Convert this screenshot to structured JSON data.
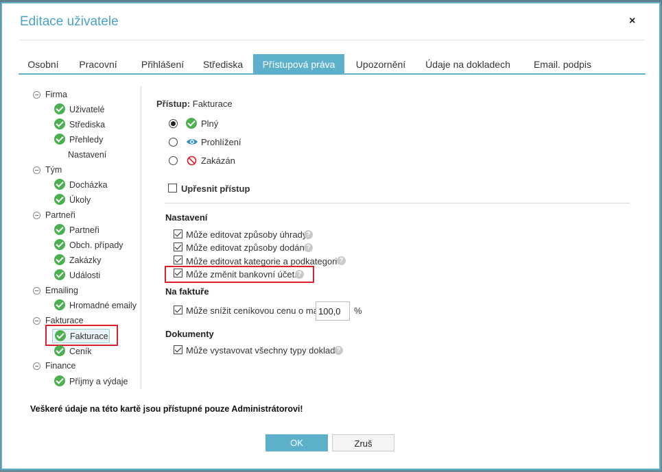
{
  "dialog": {
    "title": "Editace uživatele",
    "close_glyph": "×"
  },
  "tabs": [
    {
      "label": "Osobní"
    },
    {
      "label": "Pracovní"
    },
    {
      "label": "Přihlášení"
    },
    {
      "label": "Střediska"
    },
    {
      "label": "Přístupová práva",
      "active": true
    },
    {
      "label": "Upozornění"
    },
    {
      "label": "Údaje na dokladech"
    },
    {
      "label": "Email. podpis"
    }
  ],
  "tree": {
    "firma": "Firma",
    "uzivatele": "Uživatelé",
    "strediska": "Střediska",
    "prehledy": "Přehledy",
    "nastaveni": "Nastavení",
    "tym": "Tým",
    "dochazka": "Docházka",
    "ukoly": "Úkoly",
    "partneri_group": "Partneři",
    "partneri": "Partneři",
    "obch_pripady": "Obch. případy",
    "zakazky": "Zakázky",
    "udalosti": "Události",
    "emailing": "Emailing",
    "hromadne_emaily": "Hromadné emaily",
    "fakturace_group": "Fakturace",
    "fakturace": "Fakturace",
    "cenik": "Ceník",
    "finance": "Finance",
    "prijmy_vydaje": "Příjmy a výdaje"
  },
  "access": {
    "label": "Přístup:",
    "module": "Fakturace",
    "options": {
      "full": "Plný",
      "view": "Prohlížení",
      "denied": "Zakázán"
    },
    "refine": "Upřesnit přístup"
  },
  "settings": {
    "heading": "Nastavení",
    "payment_methods": "Může editovat způsoby úhrady",
    "delivery_methods": "Může editovat způsoby dodání",
    "categories": "Může editovat kategorie a podkategorie",
    "bank_account": "Může změnit bankovní účet."
  },
  "invoice": {
    "heading": "Na faktuře",
    "discount": "Může snížit ceníkovou cenu o max.",
    "discount_value": "100,0",
    "unit": "%"
  },
  "documents": {
    "heading": "Dokumenty",
    "all_types": "Může vystavovat všechny typy dokladů"
  },
  "help_glyph": "?",
  "footer_note": "Veškeré údaje na této kartě jsou přístupné pouze Administrátorovi!",
  "buttons": {
    "ok": "OK",
    "cancel": "Zruš"
  },
  "colors": {
    "accent": "#5db0c9",
    "green": "#4caf50",
    "highlight": "#d9202a",
    "eye": "#3a8fc7",
    "denied": "#d9202a"
  }
}
